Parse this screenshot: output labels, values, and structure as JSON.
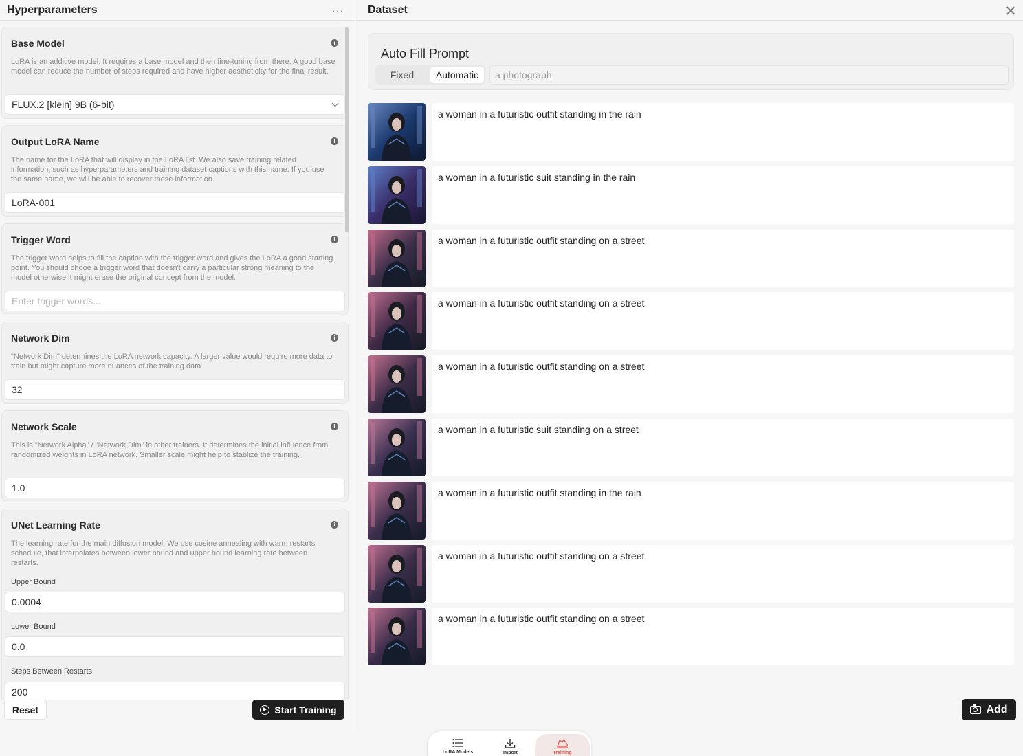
{
  "left_panel": {
    "title": "Hyperparameters",
    "more_label": "···",
    "base_model": {
      "label": "Base Model",
      "info": "i",
      "description": "LoRA is an additive model. It requires a base model and then fine-tuning from there. A good base model can reduce the number of steps required and have higher aestheticity for the final result.",
      "value": "FLUX.2 [klein] 9B (6-bit)"
    },
    "output_name": {
      "label": "Output LoRA Name",
      "info": "i",
      "description": "The name for the LoRA that will display in the LoRA list. We also save training related information, such as hyperparameters and training dataset captions with this name. If you use the same name, we will be able to recover these information.",
      "value": "LoRA-001"
    },
    "trigger_word": {
      "label": "Trigger Word",
      "info": "i",
      "description": "The trigger word helps to fill the caption with the trigger word and gives the LoRA a good starting point. You should chooe a trigger word that doesn't carry a particular strong meaning to the model otherwise it might erase the original concept from the model.",
      "placeholder": "Enter trigger words..."
    },
    "network_dim": {
      "label": "Network Dim",
      "info": "i",
      "description": "\"Network Dim\" determines the LoRA network capacity. A larger value would require more data to train but might capture more nuances of the training data.",
      "value": "32"
    },
    "network_scale": {
      "label": "Network Scale",
      "info": "i",
      "description": "This is \"Network Alpha\" / \"Network Dim\" in other trainers. It determines the initial influence from randomized weights in LoRA network. Smaller scale might help to stablize the training.",
      "value": "1.0"
    },
    "unet_lr": {
      "label": "UNet Learning Rate",
      "info": "i",
      "description": "The learning rate for the main diffusion model. We use cosine annealing with warm restarts schedule, that interpolates between lower bound and upper bound learning rate between restarts.",
      "upper_label": "Upper Bound",
      "upper_value": "0.0004",
      "lower_label": "Lower Bound",
      "lower_value": "0.0",
      "steps_label": "Steps Between Restarts",
      "steps_value": "200"
    },
    "reset_label": "Reset",
    "start_label": "Start Training"
  },
  "right_panel": {
    "title": "Dataset",
    "auto_fill": {
      "title": "Auto Fill Prompt",
      "fixed_label": "Fixed",
      "automatic_label": "Automatic",
      "selected": "Automatic",
      "prompt_value": "a photograph"
    },
    "items": [
      {
        "caption": "a woman in a futuristic outfit standing in the rain"
      },
      {
        "caption": "a woman in a futuristic suit standing in the rain"
      },
      {
        "caption": "a woman in a futuristic outfit standing on a street"
      },
      {
        "caption": "a woman in a futuristic outfit standing on a street"
      },
      {
        "caption": "a woman in a futuristic outfit standing on a street"
      },
      {
        "caption": "a woman in a futuristic suit standing on a street"
      },
      {
        "caption": "a woman in a futuristic outfit standing in the rain"
      },
      {
        "caption": "a woman in a futuristic outfit standing on a street"
      },
      {
        "caption": "a woman in a futuristic outfit standing on a street"
      }
    ],
    "add_label": "Add"
  },
  "tabbar": {
    "tabs": [
      {
        "label": "LoRA Models",
        "icon": "list-icon"
      },
      {
        "label": "Import",
        "icon": "download-icon"
      },
      {
        "label": "Training",
        "icon": "training-icon"
      }
    ],
    "active": "Training",
    "accent": "#e2574c"
  }
}
